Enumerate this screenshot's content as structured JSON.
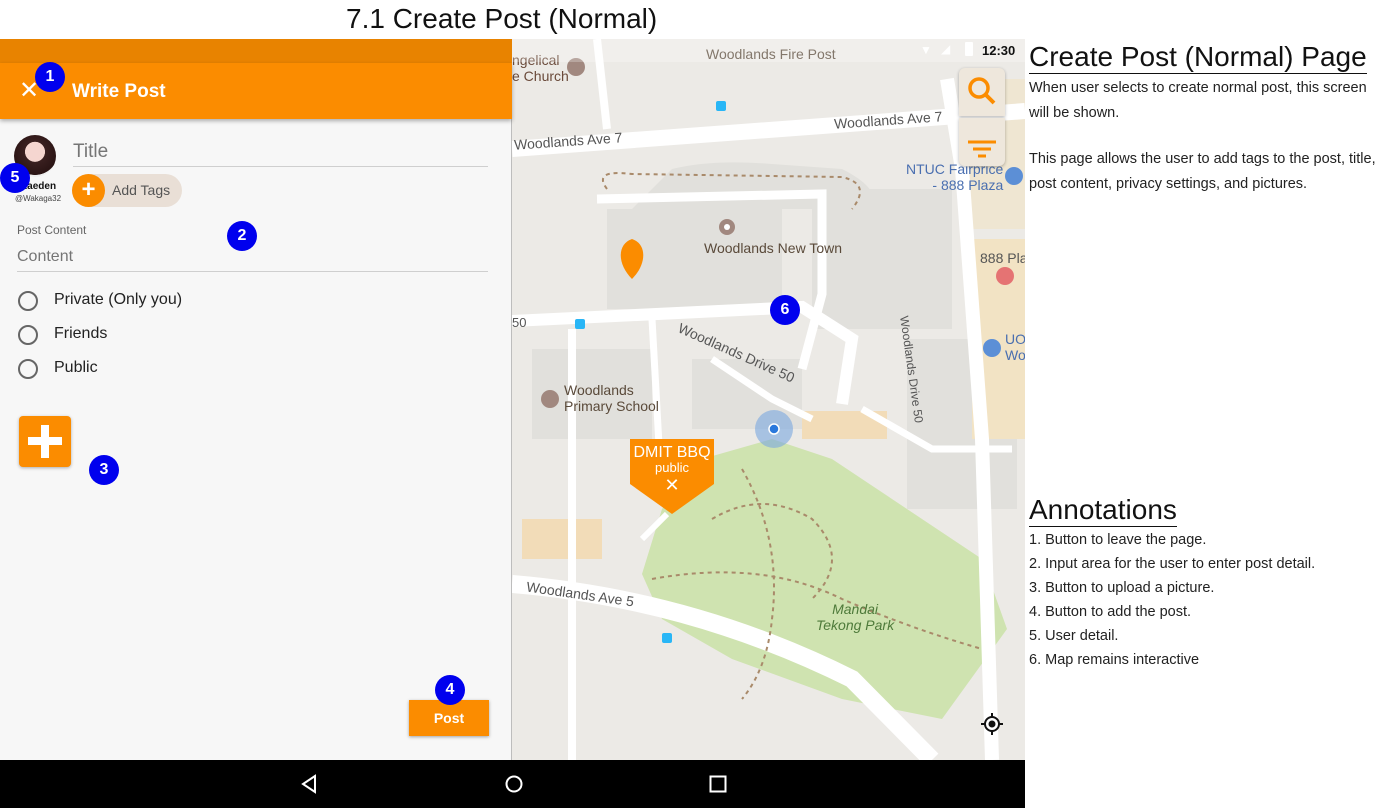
{
  "page_title": "7.1 Create Post (Normal)",
  "status_bar": {
    "time": "12:30"
  },
  "app_bar": {
    "title": "Write Post",
    "close_icon": "close-icon"
  },
  "user": {
    "name": "Kaeden",
    "handle": "@Wakaga32"
  },
  "form": {
    "title_placeholder": "Title",
    "add_tags_label": "Add Tags",
    "post_content_label": "Post Content",
    "content_placeholder": "Content",
    "privacy_options": [
      "Private (Only you)",
      "Friends",
      "Public"
    ],
    "post_button": "Post"
  },
  "map": {
    "labels": {
      "church": "ngelical\ne Church",
      "fire_post": "Woodlands Fire Post",
      "ave7_left": "Woodlands Ave 7",
      "ave7_right": "Woodlands Ave 7",
      "ntuc": "NTUC Fairprice\n- 888 Plaza",
      "new_town": "Woodlands New Town",
      "plaza": "888 Pla",
      "drive50": "Woodlands Drive 50",
      "drive50_v": "Woodlands Drive 50",
      "uob": "UO\nWo",
      "school": "Woodlands\nPrimary School",
      "ave5": "Woodlands Ave 5",
      "park": "Mandai\nTekong Park",
      "fifty": "50"
    },
    "marker": {
      "title": "DMIT BBQ",
      "subtitle": "public"
    },
    "accent": "#fb8c00"
  },
  "badges": [
    "1",
    "2",
    "3",
    "4",
    "5",
    "6"
  ],
  "doc": {
    "heading": "Create Post (Normal) Page",
    "para1": "When user selects to create normal post, this screen will be shown.",
    "para2": "This page allows the user to add tags to the post, title, post content, privacy settings, and pictures.",
    "annotations_heading": "Annotations",
    "annotations": [
      "1. Button to leave the page.",
      "2. Input area for the user to enter post detail.",
      "3. Button to upload a picture.",
      "4. Button to add the post.",
      "5. User detail.",
      "6. Map remains interactive"
    ]
  }
}
